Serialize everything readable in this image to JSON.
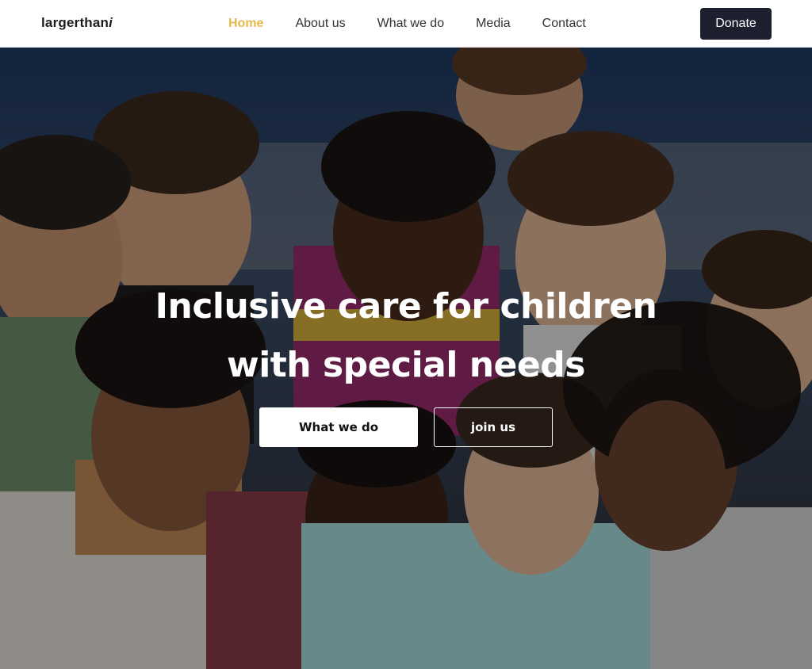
{
  "brand": {
    "name": "largerthan",
    "name_suffix": "i"
  },
  "nav": {
    "items": [
      {
        "label": "Home",
        "active": true
      },
      {
        "label": "About us",
        "active": false
      },
      {
        "label": "What we do",
        "active": false
      },
      {
        "label": "Media",
        "active": false
      },
      {
        "label": "Contact",
        "active": false
      }
    ],
    "donate_label": "Donate"
  },
  "hero": {
    "title_line1": "Inclusive care for children",
    "title_line2": "with special needs",
    "primary_button": "What we do",
    "secondary_button": "join us",
    "image_description": "group of smiling children"
  },
  "colors": {
    "accent": "#e8b74a",
    "dark": "#1e2030",
    "overlay": "rgba(0,0,0,0.38)"
  }
}
